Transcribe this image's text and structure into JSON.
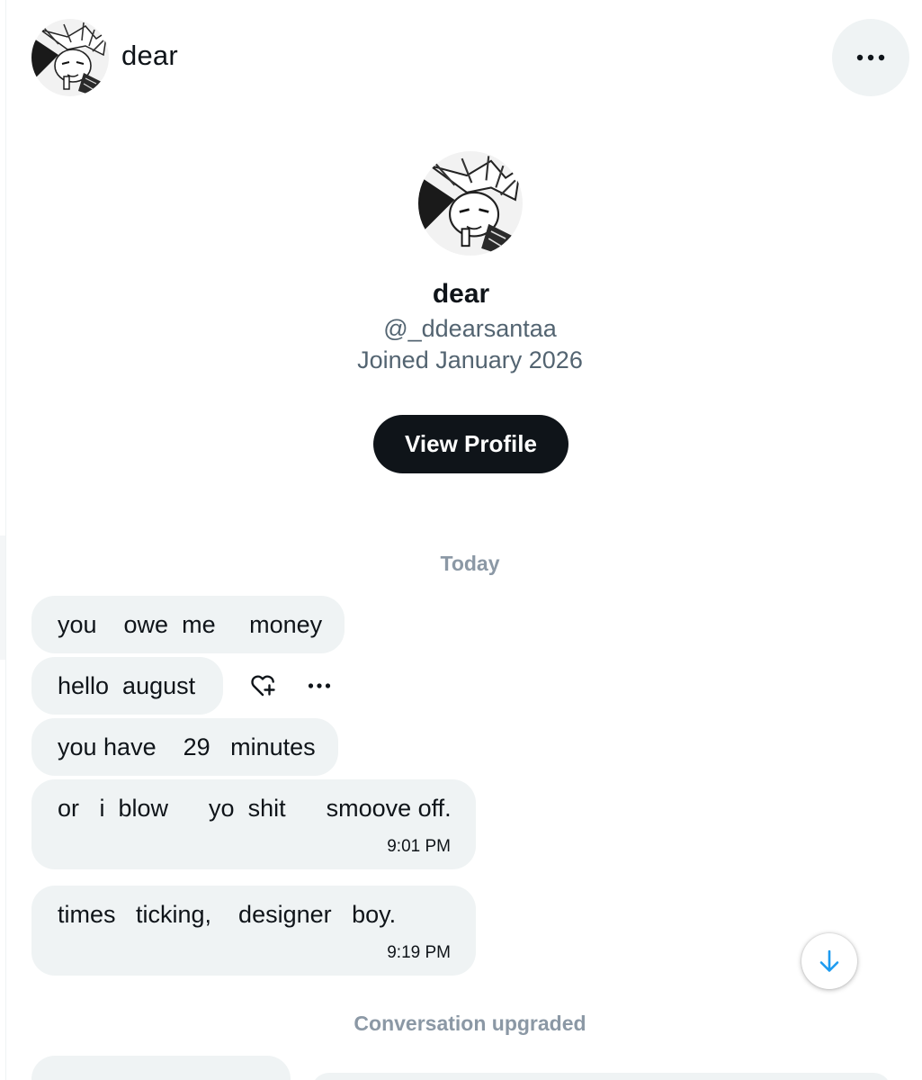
{
  "header": {
    "name": "dear",
    "avatar_icon": "profile-avatar-icon",
    "more_icon": "more-horizontal-icon"
  },
  "profile": {
    "name": "dear",
    "handle": "@_ddearsantaa",
    "joined": "Joined January 2026",
    "view_profile_label": "View Profile"
  },
  "conversation": {
    "date_divider": "Today",
    "messages": [
      {
        "text": "you    owe  me     money",
        "time": ""
      },
      {
        "text": "hello  august",
        "time": ""
      },
      {
        "text": "you have    29   minutes",
        "time": ""
      },
      {
        "text": "or   i  blow      yo  shit      smoove off.",
        "time": "9:01 PM"
      },
      {
        "text": "times   ticking,    designer   boy.",
        "time": "9:19 PM"
      }
    ],
    "upgrade_notice": "Conversation upgraded"
  },
  "icons": {
    "react": "heart-add-icon",
    "message_more": "more-horizontal-icon",
    "scroll_down": "arrow-down-icon"
  },
  "colors": {
    "text_primary": "#0f1419",
    "text_secondary": "#536471",
    "bubble": "#eff3f4",
    "button_dark": "#0f1419",
    "accent_blue": "#1d9bf0"
  }
}
